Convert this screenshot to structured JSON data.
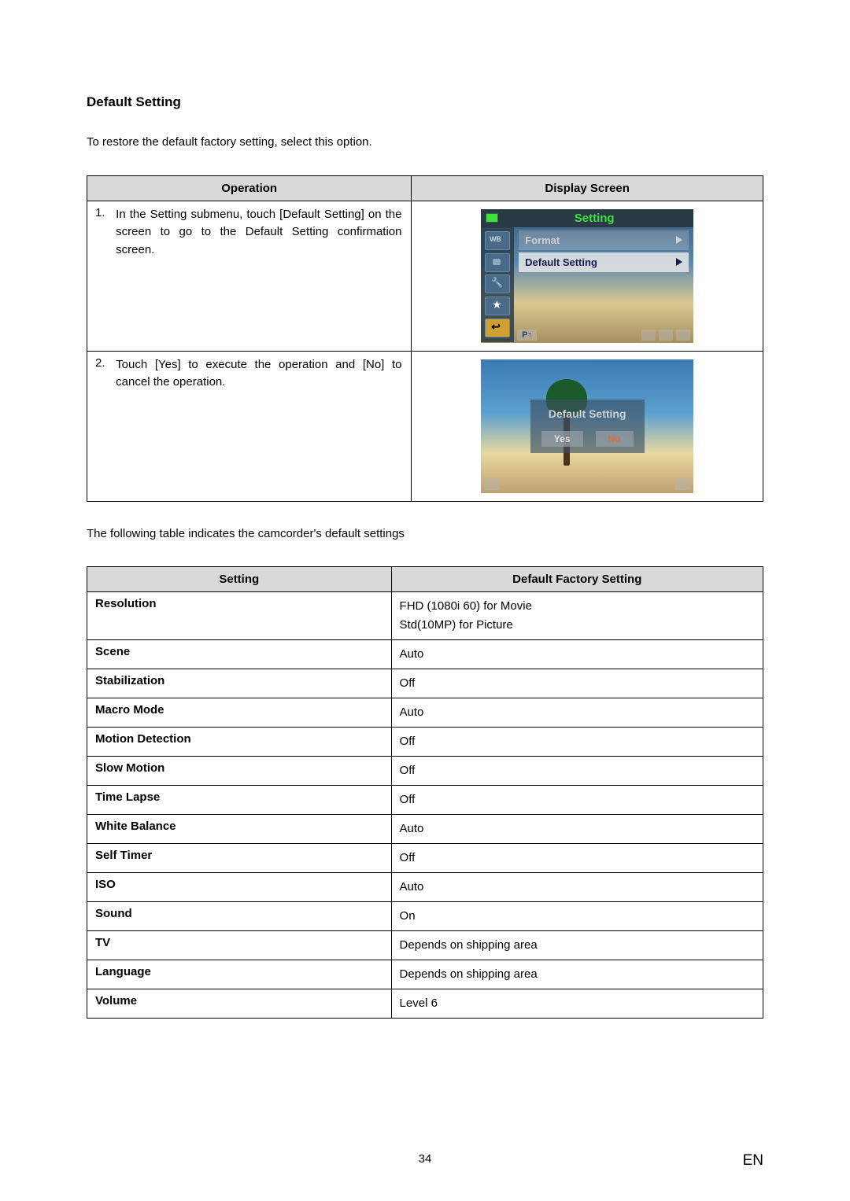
{
  "section_title": "Default Setting",
  "intro": "To restore the default factory setting, select this option.",
  "op_table": {
    "headers": {
      "operation": "Operation",
      "display": "Display Screen"
    },
    "rows": [
      {
        "num": "1.",
        "text": "In the Setting submenu, touch [Default Setting] on the screen to go to the Default Setting confirmation screen.",
        "screen": {
          "header": "Setting",
          "items": [
            {
              "label": "Format",
              "selected": false
            },
            {
              "label": "Default Setting",
              "selected": true
            }
          ],
          "page_indicator": "P↑"
        }
      },
      {
        "num": "2.",
        "text": "Touch [Yes] to execute the operation and [No] to cancel the operation.",
        "dialog": {
          "title": "Default Setting",
          "yes": "Yes",
          "no": "No"
        }
      }
    ]
  },
  "defaults_intro": "The following table indicates the camcorder's default settings",
  "defaults_table": {
    "headers": {
      "setting": "Setting",
      "default": "Default Factory Setting"
    },
    "rows": [
      {
        "setting": "Resolution",
        "value": "FHD (1080i 60) for Movie\nStd(10MP) for Picture"
      },
      {
        "setting": "Scene",
        "value": "Auto"
      },
      {
        "setting": "Stabilization",
        "value": "Off"
      },
      {
        "setting": "Macro Mode",
        "value": "Auto"
      },
      {
        "setting": "Motion Detection",
        "value": "Off"
      },
      {
        "setting": "Slow Motion",
        "value": "Off"
      },
      {
        "setting": "Time Lapse",
        "value": "Off"
      },
      {
        "setting": "White Balance",
        "value": "Auto"
      },
      {
        "setting": "Self Timer",
        "value": "Off"
      },
      {
        "setting": "ISO",
        "value": "Auto"
      },
      {
        "setting": "Sound",
        "value": "On"
      },
      {
        "setting": "TV",
        "value": "Depends on shipping area"
      },
      {
        "setting": "Language",
        "value": "Depends on shipping area"
      },
      {
        "setting": "Volume",
        "value": "Level 6"
      }
    ]
  },
  "footer": {
    "page": "34",
    "lang": "EN"
  }
}
